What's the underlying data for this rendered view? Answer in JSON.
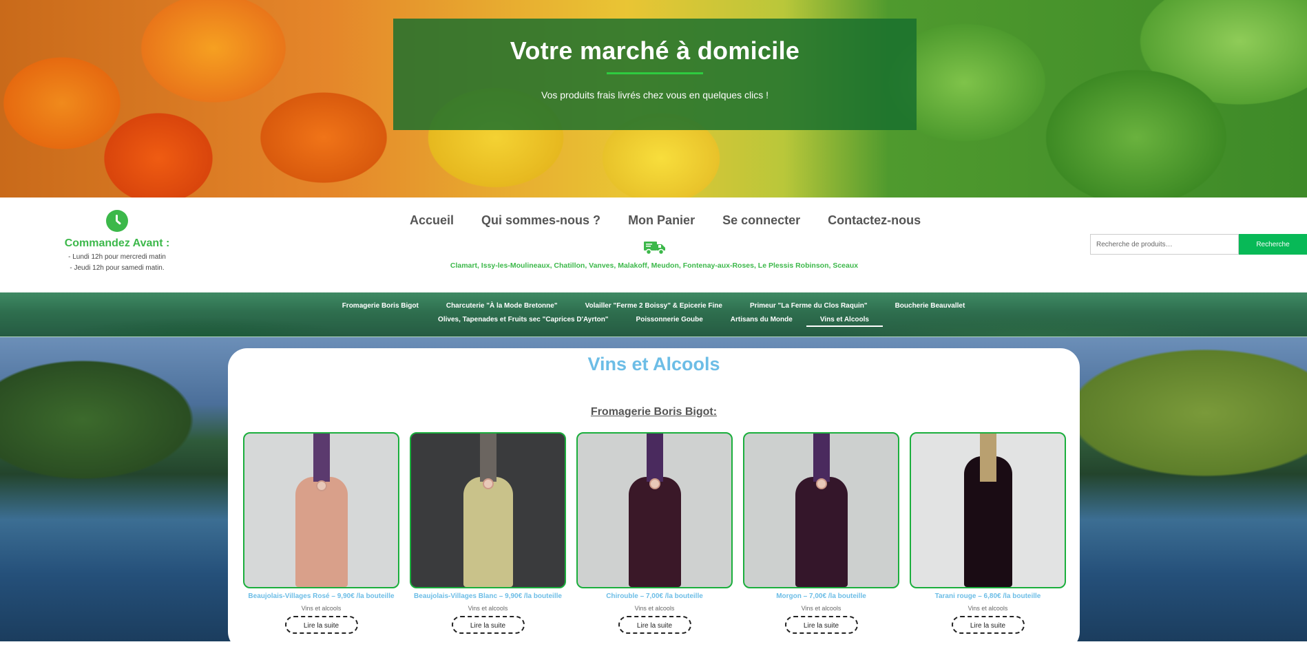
{
  "hero": {
    "title": "Votre marché à domicile",
    "subtitle": "Vos produits frais livrés chez vous en quelques clics !"
  },
  "order": {
    "icon": "clock-icon",
    "title": "Commandez Avant :",
    "lines": [
      "- Lundi 12h pour mercredi matin",
      "- Jeudi 12h pour samedi matin."
    ]
  },
  "nav": {
    "items": [
      "Accueil",
      "Qui sommes-nous ?",
      "Mon Panier",
      "Se connecter",
      "Contactez-nous"
    ]
  },
  "delivery": {
    "icon": "truck-icon",
    "cities": "Clamart, Issy-les-Moulineaux, Chatillon, Vanves, Malakoff, Meudon, Fontenay-aux-Roses, Le Plessis Robinson, Sceaux"
  },
  "search": {
    "placeholder": "Recherche de produits…",
    "button": "Recherche"
  },
  "categories": {
    "row1": [
      "Fromagerie Boris Bigot",
      "Charcuterie \"À la Mode Bretonne\"",
      "Volailler \"Ferme 2 Boissy\" & Epicerie Fine",
      "Primeur \"La Ferme du Clos Raquin\"",
      "Boucherie Beauvallet"
    ],
    "row2": [
      "Olives, Tapenades et Fruits sec \"Caprices D'Ayrton\"",
      "Poissonnerie Goube",
      "Artisans du Monde",
      "Vins et Alcools"
    ],
    "active": "Vins et Alcools"
  },
  "page": {
    "title": "Vins et Alcools",
    "section": "Fromagerie Boris Bigot:"
  },
  "products": [
    {
      "name": "Beaujolais-Villages Rosé – 9,90€ /la bouteille",
      "category": "Vins et alcools",
      "button": "Lire la suite",
      "bottle_color": "#d9a08a",
      "bg": "#d6d8d8"
    },
    {
      "name": "Beaujolais-Villages Blanc – 9,90€ /la bouteille",
      "category": "Vins et alcools",
      "button": "Lire la suite",
      "bottle_color": "#c9c28a",
      "bg": "#3a3b3d"
    },
    {
      "name": "Chirouble – 7,00€ /la bouteille",
      "category": "Vins et alcools",
      "button": "Lire la suite",
      "bottle_color": "#3a1828",
      "bg": "#cfd1d0"
    },
    {
      "name": "Morgon – 7,00€ /la bouteille",
      "category": "Vins et alcools",
      "button": "Lire la suite",
      "bottle_color": "#34162a",
      "bg": "#cdd0cf"
    },
    {
      "name": "Tarani rouge – 6,80€ /la bouteille",
      "category": "Vins et alcools",
      "button": "Lire la suite",
      "bottle_color": "#1a0c14",
      "bg": "#e2e3e3"
    }
  ]
}
